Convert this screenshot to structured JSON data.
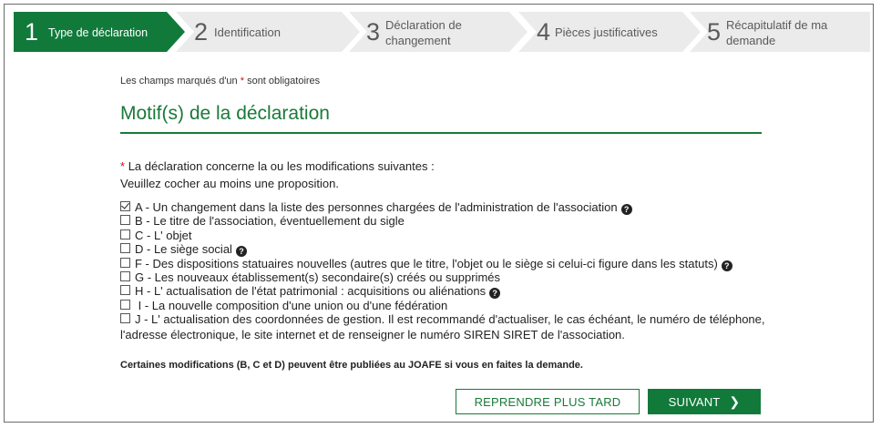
{
  "stepper": {
    "steps": [
      {
        "number": "1",
        "label": "Type de déclaration",
        "active": true
      },
      {
        "number": "2",
        "label": "Identification",
        "active": false
      },
      {
        "number": "3",
        "label_line1": "Déclaration de",
        "label_line2": "changement",
        "active": false
      },
      {
        "number": "4",
        "label": "Pièces justificatives",
        "active": false
      },
      {
        "number": "5",
        "label_line1": "Récapitulatif de ma",
        "label_line2": "demande",
        "active": false
      }
    ],
    "active_color": "#117a3a",
    "inactive_color": "#ebebeb"
  },
  "form": {
    "required_note_prefix": "Les champs marqués d'un ",
    "required_star": "*",
    "required_note_suffix": " sont obligatoires",
    "section_title": "Motif(s) de la déclaration",
    "question": "La déclaration concerne la ou les modifications suivantes :",
    "instruction": "Veuillez cocher au moins une proposition.",
    "options": [
      {
        "text": "A - Un changement dans la liste des personnes chargées de l'administration de l'association",
        "checked": true,
        "help": true
      },
      {
        "text": "B - Le titre de l'association, éventuellement du sigle",
        "checked": false,
        "help": false
      },
      {
        "text": "C - L' objet",
        "checked": false,
        "help": false
      },
      {
        "text": "D - Le siège social",
        "checked": false,
        "help": true
      },
      {
        "text": "F - Des dispositions statuaires nouvelles (autres que le titre, l'objet ou le siège si celui-ci figure dans les statuts)",
        "checked": false,
        "help": true
      },
      {
        "text": "G - Les nouveaux établissement(s) secondaire(s) créés ou supprimés",
        "checked": false,
        "help": false
      },
      {
        "text": "H - L' actualisation de l'état patrimonial : acquisitions ou aliénations",
        "checked": false,
        "help": true
      },
      {
        "text": " I - La nouvelle composition d'une union ou d'une fédération",
        "checked": false,
        "help": false
      },
      {
        "text": "J - L' actualisation des coordonnées de gestion. Il est recommandé d'actualiser, le cas échéant, le numéro de téléphone,",
        "text_line2": "l'adresse électronique, le site internet et de renseigner le numéro SIREN SIRET de l'association.",
        "checked": false,
        "help": false
      }
    ],
    "help_icon_glyph": "?",
    "footnote": "Certaines modifications (B, C et D) peuvent être publiées au JOAFE si vous en faites la demande."
  },
  "actions": {
    "later_label": "REPRENDRE PLUS TARD",
    "next_label": "SUIVANT",
    "next_icon": "chevron-right-icon",
    "next_icon_glyph": "❯"
  },
  "colors": {
    "brand_green": "#117a3a",
    "title_green": "#1a7a3a",
    "required_red": "#d0121b"
  }
}
